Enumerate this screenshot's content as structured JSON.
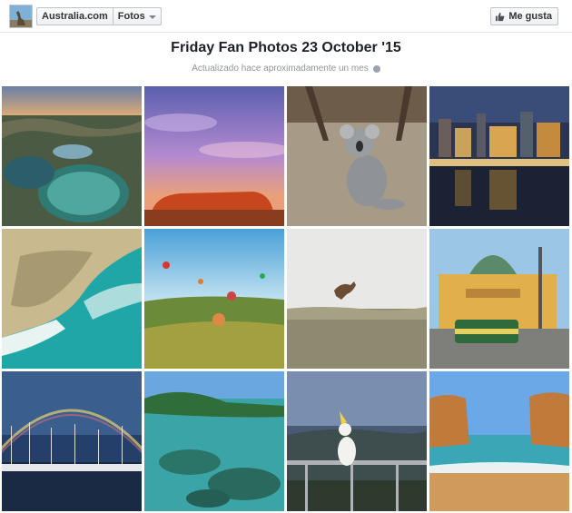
{
  "header": {
    "page_name": "Australia.com",
    "section": "Fotos",
    "like_label": "Me gusta"
  },
  "album": {
    "title": "Friday Fan Photos 23 October '15",
    "updated": "Actualizado hace aproximadamente un mes"
  },
  "icons": {
    "avatar": "kangaroo-avatar-icon",
    "dropdown": "chevron-down-icon",
    "like": "thumbs-up-icon",
    "privacy": "globe-icon"
  },
  "photos": [
    {
      "subject": "coastal rock pools at sunset"
    },
    {
      "subject": "Uluru under purple sky"
    },
    {
      "subject": "koala on ground"
    },
    {
      "subject": "city waterfront at night"
    },
    {
      "subject": "aerial coastline cliffs"
    },
    {
      "subject": "hot air balloons over valley"
    },
    {
      "subject": "kangaroo jumping in field"
    },
    {
      "subject": "Flinders Street station with tram"
    },
    {
      "subject": "marina with rainbow"
    },
    {
      "subject": "clear water cove"
    },
    {
      "subject": "cockatoo on railing"
    },
    {
      "subject": "sea rock stacks and beach"
    }
  ]
}
